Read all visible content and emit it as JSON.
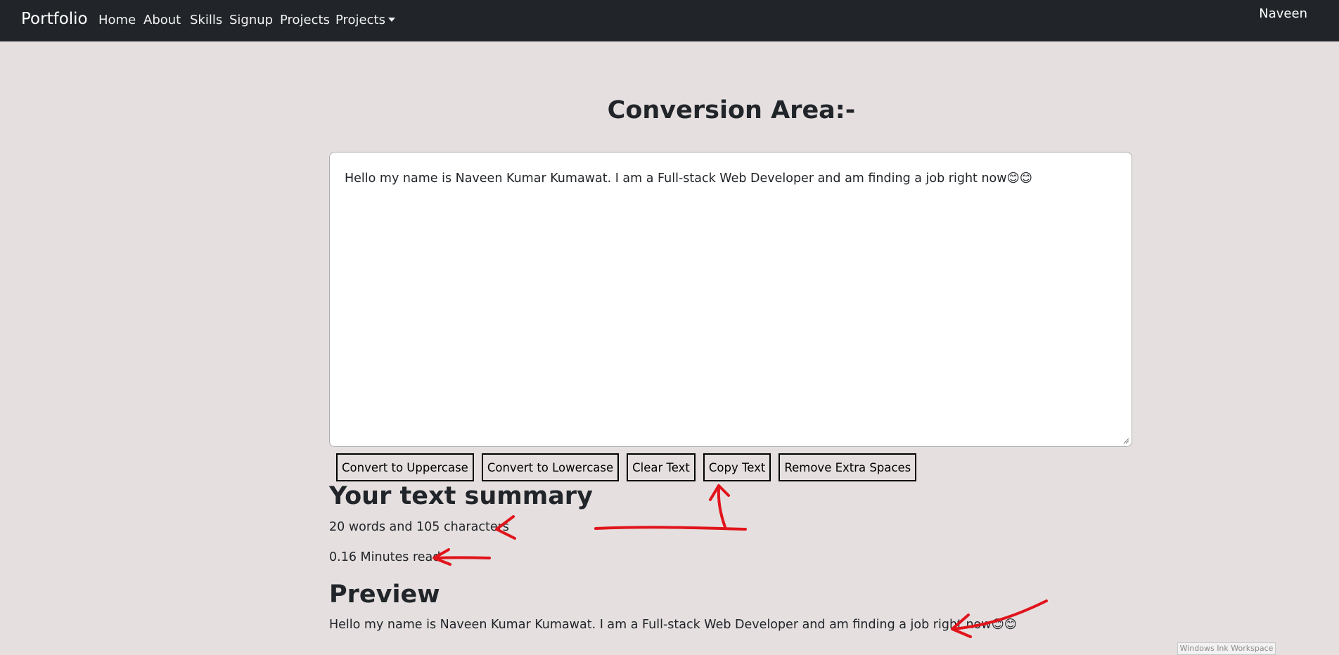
{
  "navbar": {
    "brand": "Portfolio",
    "links": [
      "Home",
      "About",
      "Skills",
      "Signup",
      "Projects"
    ],
    "dropdown_label": "Projects",
    "user": "Naveen"
  },
  "main": {
    "heading": "Conversion Area:-",
    "textarea_value": "Hello my name is Naveen Kumar Kumawat. I am a Full-stack Web Developer and am finding a job right now😊😊",
    "buttons": [
      "Convert to Uppercase",
      "Convert to Lowercase",
      "Clear Text",
      "Copy Text",
      "Remove Extra Spaces"
    ],
    "summary_title": "Your text summary",
    "summary_counts": "20 words and 105 characters",
    "summary_read_time": "0.16 Minutes read",
    "preview_title": "Preview",
    "preview_text": "Hello my name is Naveen Kumar Kumawat. I am a Full-stack Web Developer and am finding a job right now😊😊"
  },
  "overlay": {
    "ink_workspace_label": "Windows Ink Workspace"
  },
  "colors": {
    "navbar_bg": "#212529",
    "page_bg": "#e5dfdf",
    "annotation_ink": "#e1141b"
  },
  "icons": {
    "dropdown": "caret-down-icon",
    "resize": "resize-handle-icon"
  }
}
